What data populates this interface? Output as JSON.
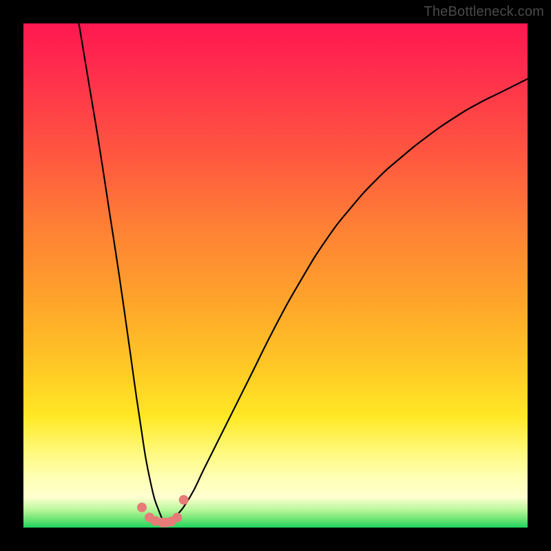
{
  "watermark": "TheBottleneck.com",
  "chart_data": {
    "type": "line",
    "title": "",
    "xlabel": "",
    "ylabel": "",
    "xlim": [
      0,
      100
    ],
    "ylim": [
      0,
      100
    ],
    "series": [
      {
        "name": "bottleneck-curve",
        "x": [
          11,
          13,
          15,
          17,
          19,
          21,
          23,
          25,
          27,
          28.5,
          30,
          33,
          36,
          40,
          45,
          50,
          55,
          60,
          65,
          70,
          75,
          80,
          85,
          90,
          95,
          100
        ],
        "values": [
          100,
          88,
          76,
          63,
          50,
          36,
          22,
          10,
          3,
          1,
          2,
          6,
          12,
          20,
          30,
          40,
          49,
          57,
          63.5,
          69,
          73.5,
          77.5,
          81,
          84,
          86.5,
          89
        ]
      }
    ],
    "markers": {
      "name": "highlight-points",
      "color": "#e67b78",
      "x": [
        23.5,
        25.0,
        26.2,
        27.6,
        28.3,
        29.3,
        30.5,
        31.8
      ],
      "values": [
        4.0,
        2.0,
        1.3,
        1.0,
        1.0,
        1.2,
        2.0,
        5.5
      ]
    },
    "background_gradient_stops": [
      {
        "pos": 0,
        "color": "#ff1850"
      },
      {
        "pos": 0.55,
        "color": "#ffa42b"
      },
      {
        "pos": 0.85,
        "color": "#fff97b"
      },
      {
        "pos": 0.97,
        "color": "#7ce87a"
      },
      {
        "pos": 1.0,
        "color": "#1fd35e"
      }
    ]
  }
}
